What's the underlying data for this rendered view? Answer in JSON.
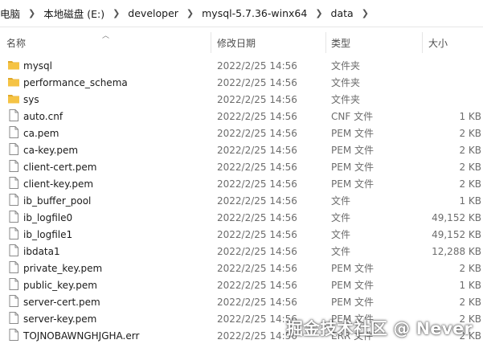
{
  "breadcrumb": [
    "电脑",
    "本地磁盘 (E:)",
    "developer",
    "mysql-5.7.36-winx64",
    "data"
  ],
  "columns": {
    "name": "名称",
    "date": "修改日期",
    "type": "类型",
    "size": "大小"
  },
  "files": [
    {
      "name": "mysql",
      "date": "2022/2/25 14:56",
      "type": "文件夹",
      "size": "",
      "icon": "folder-icon"
    },
    {
      "name": "performance_schema",
      "date": "2022/2/25 14:56",
      "type": "文件夹",
      "size": "",
      "icon": "folder-icon"
    },
    {
      "name": "sys",
      "date": "2022/2/25 14:56",
      "type": "文件夹",
      "size": "",
      "icon": "folder-icon"
    },
    {
      "name": "auto.cnf",
      "date": "2022/2/25 14:56",
      "type": "CNF 文件",
      "size": "1 KB",
      "icon": "file-icon"
    },
    {
      "name": "ca.pem",
      "date": "2022/2/25 14:56",
      "type": "PEM 文件",
      "size": "2 KB",
      "icon": "file-icon"
    },
    {
      "name": "ca-key.pem",
      "date": "2022/2/25 14:56",
      "type": "PEM 文件",
      "size": "2 KB",
      "icon": "file-icon"
    },
    {
      "name": "client-cert.pem",
      "date": "2022/2/25 14:56",
      "type": "PEM 文件",
      "size": "2 KB",
      "icon": "file-icon"
    },
    {
      "name": "client-key.pem",
      "date": "2022/2/25 14:56",
      "type": "PEM 文件",
      "size": "2 KB",
      "icon": "file-icon"
    },
    {
      "name": "ib_buffer_pool",
      "date": "2022/2/25 14:56",
      "type": "文件",
      "size": "1 KB",
      "icon": "file-icon"
    },
    {
      "name": "ib_logfile0",
      "date": "2022/2/25 14:56",
      "type": "文件",
      "size": "49,152 KB",
      "icon": "file-icon"
    },
    {
      "name": "ib_logfile1",
      "date": "2022/2/25 14:56",
      "type": "文件",
      "size": "49,152 KB",
      "icon": "file-icon"
    },
    {
      "name": "ibdata1",
      "date": "2022/2/25 14:56",
      "type": "文件",
      "size": "12,288 KB",
      "icon": "file-icon"
    },
    {
      "name": "private_key.pem",
      "date": "2022/2/25 14:56",
      "type": "PEM 文件",
      "size": "2 KB",
      "icon": "file-icon"
    },
    {
      "name": "public_key.pem",
      "date": "2022/2/25 14:56",
      "type": "PEM 文件",
      "size": "1 KB",
      "icon": "file-icon"
    },
    {
      "name": "server-cert.pem",
      "date": "2022/2/25 14:56",
      "type": "PEM 文件",
      "size": "2 KB",
      "icon": "file-icon"
    },
    {
      "name": "server-key.pem",
      "date": "2022/2/25 14:56",
      "type": "PEM 文件",
      "size": "2 KB",
      "icon": "file-icon"
    },
    {
      "name": "TOJNOBAWNGHJGHA.err",
      "date": "2022/2/25 14:56",
      "type": "ERR 文件",
      "size": "2 KB",
      "icon": "file-icon"
    }
  ],
  "watermark": "掘金技术社区 @ Never",
  "colors": {
    "folder": "#f5c344",
    "folder_tab": "#e0a92a",
    "file_border": "#8a8a8a"
  }
}
